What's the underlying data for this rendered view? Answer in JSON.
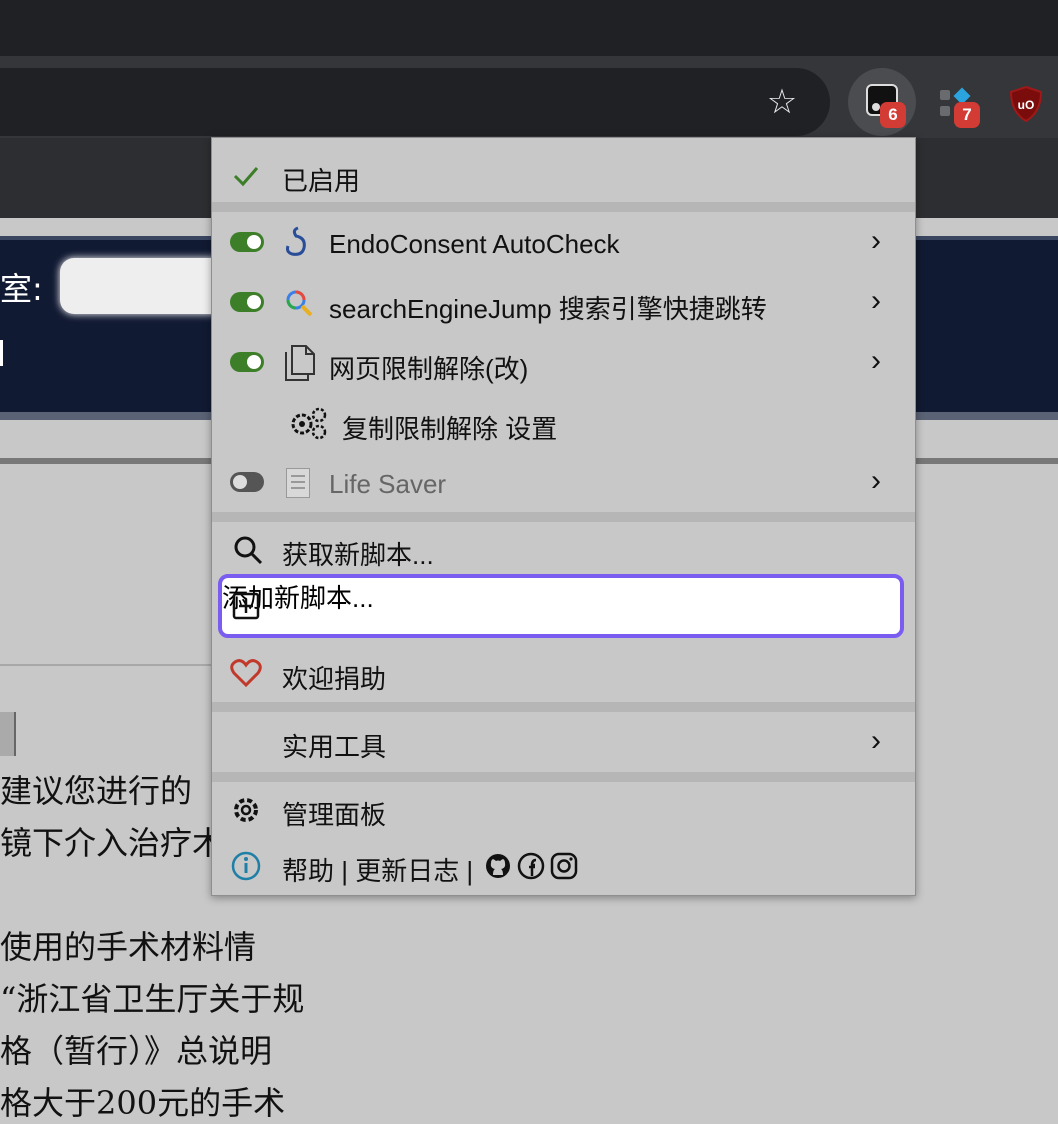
{
  "browser": {
    "extensions": [
      {
        "name": "Tampermonkey",
        "badge": "6"
      },
      {
        "name": "Extension",
        "badge": "7"
      },
      {
        "name": "uBlock Origin",
        "badge": ""
      }
    ]
  },
  "page": {
    "room_label": "室:",
    "lines": [
      "建议您进行的",
      "镜下介入治疗术",
      "使用的手术材料情",
      "“浙江省卫生厅关于规",
      "格（暂行）》总说明",
      "格大于200元的手术"
    ]
  },
  "menu": {
    "enabled_label": "已启用",
    "scripts": [
      {
        "name": "EndoConsent AutoCheck",
        "enabled": true,
        "icon": "stomach-icon"
      },
      {
        "name": "searchEngineJump 搜索引擎快捷跳转",
        "enabled": true,
        "icon": "magnifier-color-icon"
      },
      {
        "name": "网页限制解除(改)",
        "enabled": true,
        "icon": "document-icon"
      },
      {
        "name": "Life Saver",
        "enabled": false,
        "icon": "notepad-icon"
      }
    ],
    "sub_command": "复制限制解除 设置",
    "get_new": "获取新脚本...",
    "add_new": "添加新脚本...",
    "donate": "欢迎捐助",
    "utilities": "实用工具",
    "dashboard": "管理面板",
    "help": "帮助 | 更新日志 |",
    "colors": {
      "accent": "#7a5cf0",
      "toggle_on": "#3d7e28",
      "heart": "#c0392b",
      "info": "#1f7fa6"
    }
  }
}
